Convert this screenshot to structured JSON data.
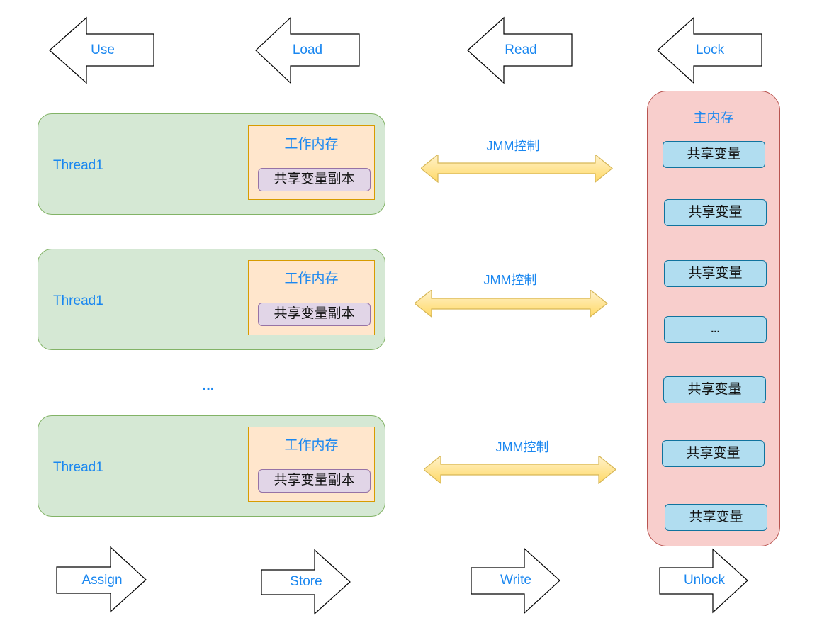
{
  "top_operations": [
    {
      "label": "Use",
      "direction": "left"
    },
    {
      "label": "Load",
      "direction": "left"
    },
    {
      "label": "Read",
      "direction": "left"
    },
    {
      "label": "Lock",
      "direction": "left"
    }
  ],
  "bottom_operations": [
    {
      "label": "Assign",
      "direction": "right"
    },
    {
      "label": "Store",
      "direction": "right"
    },
    {
      "label": "Write",
      "direction": "right"
    },
    {
      "label": "Unlock",
      "direction": "right"
    }
  ],
  "threads": [
    {
      "label": "Thread1",
      "work_memory": {
        "title": "工作内存",
        "copy_label": "共享变量副本"
      },
      "jmm_label": "JMM控制"
    },
    {
      "label": "Thread1",
      "work_memory": {
        "title": "工作内存",
        "copy_label": "共享变量副本"
      },
      "jmm_label": "JMM控制"
    },
    {
      "label": "Thread1",
      "work_memory": {
        "title": "工作内存",
        "copy_label": "共享变量副本"
      },
      "jmm_label": "JMM控制"
    }
  ],
  "threads_ellipsis": "...",
  "main_memory": {
    "title": "主内存",
    "variables": [
      "共享变量",
      "共享变量",
      "共享变量",
      "...",
      "共享变量",
      "共享变量",
      "共享变量"
    ]
  },
  "colors": {
    "label_text": "#1a87f0",
    "thread_fill": "#d5e8d4",
    "thread_stroke": "#82b366",
    "work_memory_fill": "#ffe6cc",
    "work_memory_stroke": "#d79b00",
    "copy_fill": "#e1d5e7",
    "copy_stroke": "#9673a6",
    "main_memory_fill": "#f8cecc",
    "main_memory_stroke": "#b85450",
    "variable_fill": "#b1ddf0",
    "variable_stroke": "#10739e",
    "jmm_arrow_fill": "#ffd966",
    "jmm_arrow_stroke": "#d6b656"
  }
}
